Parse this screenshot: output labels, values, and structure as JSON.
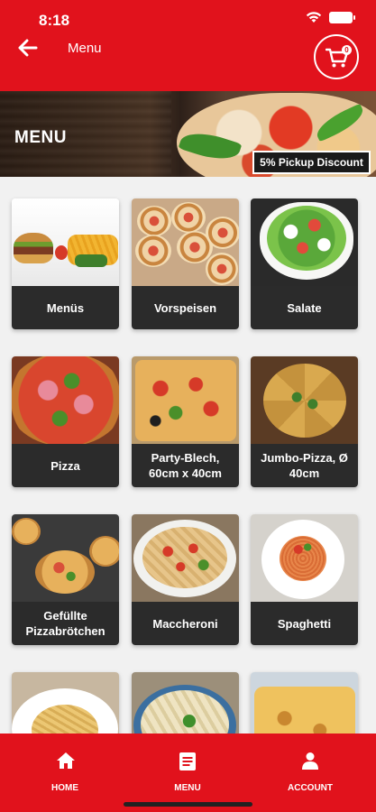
{
  "status_bar": {
    "time": "8:18"
  },
  "header": {
    "title": "Menu",
    "cart_count": "0"
  },
  "banner": {
    "title": "MENU",
    "discount_label": "5% Pickup Discount"
  },
  "categories": [
    {
      "label": "Menüs"
    },
    {
      "label": "Vorspeisen"
    },
    {
      "label": "Salate"
    },
    {
      "label": "Pizza"
    },
    {
      "label": "Party-Blech, 60cm x 40cm"
    },
    {
      "label": "Jumbo-Pizza, Ø 40cm"
    },
    {
      "label": "Gefüllte Pizzabrötchen"
    },
    {
      "label": "Maccheroni"
    },
    {
      "label": "Spaghetti"
    }
  ],
  "bottom_nav": {
    "home_label": "HOME",
    "menu_label": "MENU",
    "account_label": "ACCOUNT"
  },
  "colors": {
    "brand_red": "#e1121c",
    "caption_bg": "#2b2b2b",
    "page_bg": "#f1f1f1"
  }
}
